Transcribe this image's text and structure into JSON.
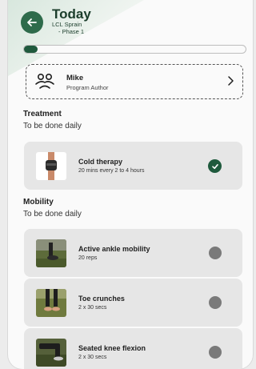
{
  "header": {
    "title": "Today",
    "subtitle_line1": "LCL Sprain",
    "subtitle_line2": "- Phase 1",
    "back_icon": "arrow-left-icon",
    "accent_color": "#2e6b4b"
  },
  "progress": {
    "fraction": 0.06
  },
  "author": {
    "name": "Mike",
    "role": "Program Author",
    "icon": "users-icon"
  },
  "sections": [
    {
      "title": "Treatment",
      "subtitle": "To be done daily",
      "items": [
        {
          "title": "Cold therapy",
          "detail": "20 mins every 2 to 4 hours",
          "completed": true
        }
      ]
    },
    {
      "title": "Mobility",
      "subtitle": "To be done daily",
      "items": [
        {
          "title": "Active ankle mobility",
          "detail": "20 reps",
          "completed": false
        },
        {
          "title": "Toe crunches",
          "detail": "2 x 30 secs",
          "completed": false
        },
        {
          "title": "Seated knee flexion",
          "detail": "2 x 30 secs",
          "completed": false
        }
      ]
    }
  ]
}
